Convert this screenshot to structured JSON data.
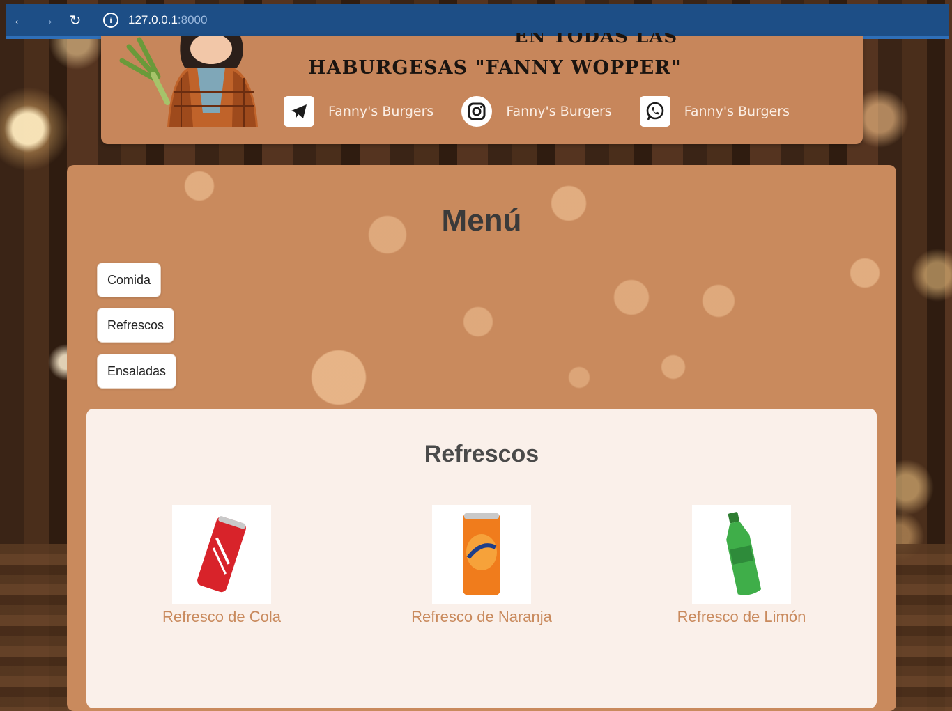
{
  "browser": {
    "host": "127.0.0.1",
    "port": ":8000"
  },
  "header": {
    "title_top": "EN TODAS LAS",
    "title_main": "HABURGESAS \"FANNY WOPPER\"",
    "social": [
      {
        "icon": "telegram-icon",
        "label": "Fanny's Burgers"
      },
      {
        "icon": "instagram-icon",
        "label": "Fanny's Burgers"
      },
      {
        "icon": "whatsapp-icon",
        "label": "Fanny's Burgers"
      }
    ]
  },
  "menu": {
    "title": "Menú",
    "categories": [
      "Comida",
      "Refrescos",
      "Ensaladas"
    ]
  },
  "section": {
    "title": "Refrescos",
    "products": [
      {
        "name": "Refresco de Cola",
        "image": "cola-can-image",
        "color": "#d8232a"
      },
      {
        "name": "Refresco de Naranja",
        "image": "orange-soda-can-image",
        "color": "#f07c1c"
      },
      {
        "name": "Refresco de Limón",
        "image": "lime-soda-bottle-image",
        "color": "#3fae49"
      }
    ]
  },
  "colors": {
    "accent": "#c98a5d",
    "browser_bar": "#1d4e86"
  }
}
